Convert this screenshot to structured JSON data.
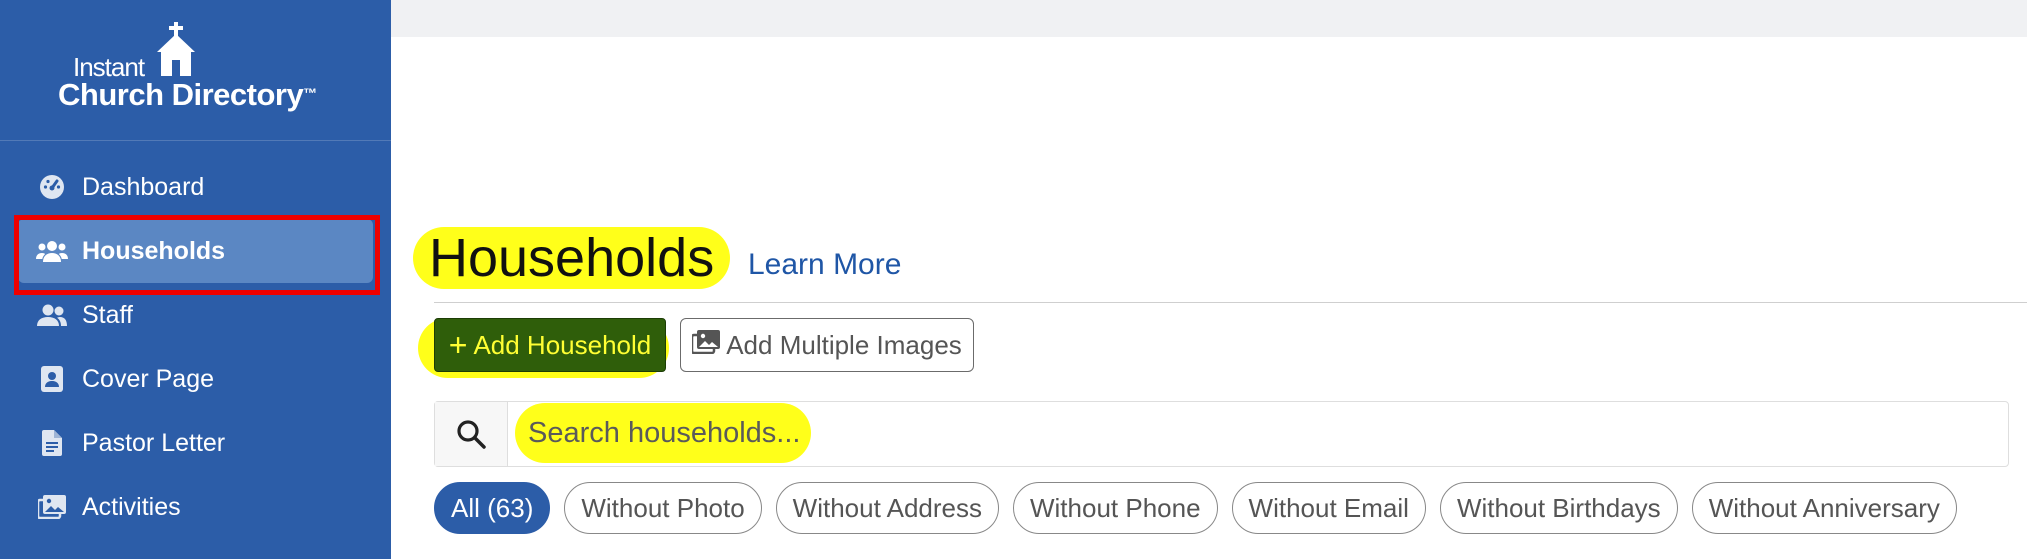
{
  "brand": {
    "line1": "Instant",
    "line2": "Church Directory",
    "tm": "™"
  },
  "sidebar": {
    "items": [
      {
        "label": "Dashboard",
        "icon": "dashboard-gauge-icon"
      },
      {
        "label": "Households",
        "icon": "users-icon",
        "active": true
      },
      {
        "label": "Staff",
        "icon": "user-group-icon"
      },
      {
        "label": "Cover Page",
        "icon": "id-card-icon"
      },
      {
        "label": "Pastor Letter",
        "icon": "file-text-icon"
      },
      {
        "label": "Activities",
        "icon": "images-icon"
      }
    ]
  },
  "main": {
    "title": "Households",
    "learn_more": "Learn More",
    "add_household": "Add Household",
    "add_multiple_images": "Add Multiple Images",
    "search": {
      "placeholder": "Search households..."
    },
    "filters": [
      {
        "label": "All (63)",
        "active": true
      },
      {
        "label": "Without Photo"
      },
      {
        "label": "Without Address"
      },
      {
        "label": "Without Phone"
      },
      {
        "label": "Without Email"
      },
      {
        "label": "Without Birthdays"
      },
      {
        "label": "Without Anniversary"
      }
    ]
  },
  "colors": {
    "sidebar_bg": "#2c5da8",
    "active_item_bg": "#5b87c3",
    "highlight": "#ffff1a",
    "active_outline": "#ee0000",
    "add_button_bg": "#2f5e0a",
    "link": "#1f56a6"
  }
}
